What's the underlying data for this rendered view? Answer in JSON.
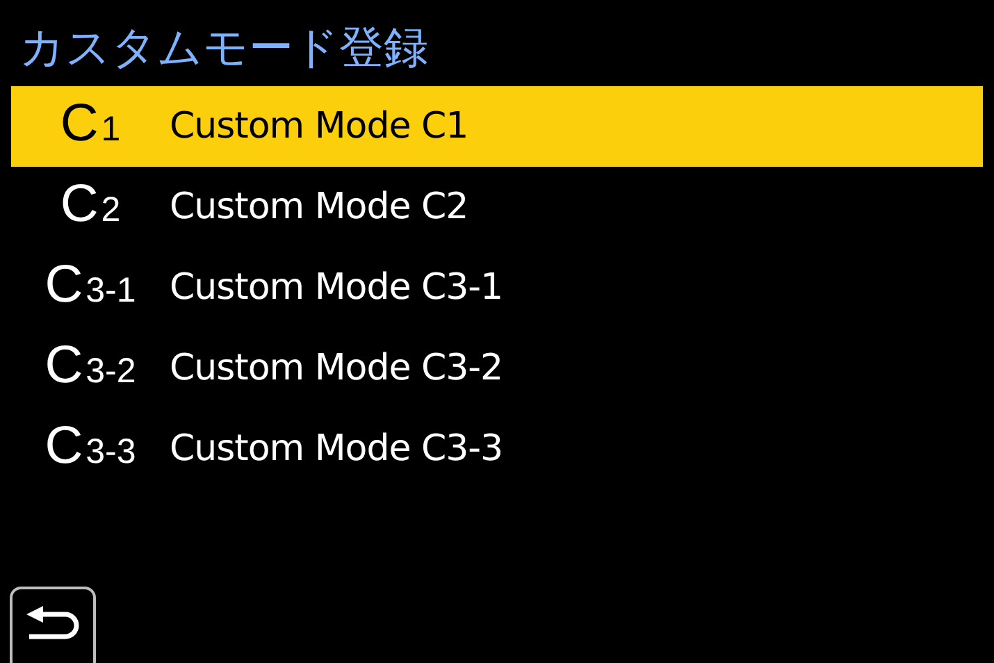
{
  "title": "カスタムモード登録",
  "items": [
    {
      "mode": "C",
      "number": "1",
      "label": "Custom Mode C1",
      "selected": true
    },
    {
      "mode": "C",
      "number": "2",
      "label": "Custom Mode C2",
      "selected": false
    },
    {
      "mode": "C",
      "number": "3-1",
      "label": "Custom Mode C3-1",
      "selected": false
    },
    {
      "mode": "C",
      "number": "3-2",
      "label": "Custom Mode C3-2",
      "selected": false
    },
    {
      "mode": "C",
      "number": "3-3",
      "label": "Custom Mode C3-3",
      "selected": false
    }
  ]
}
